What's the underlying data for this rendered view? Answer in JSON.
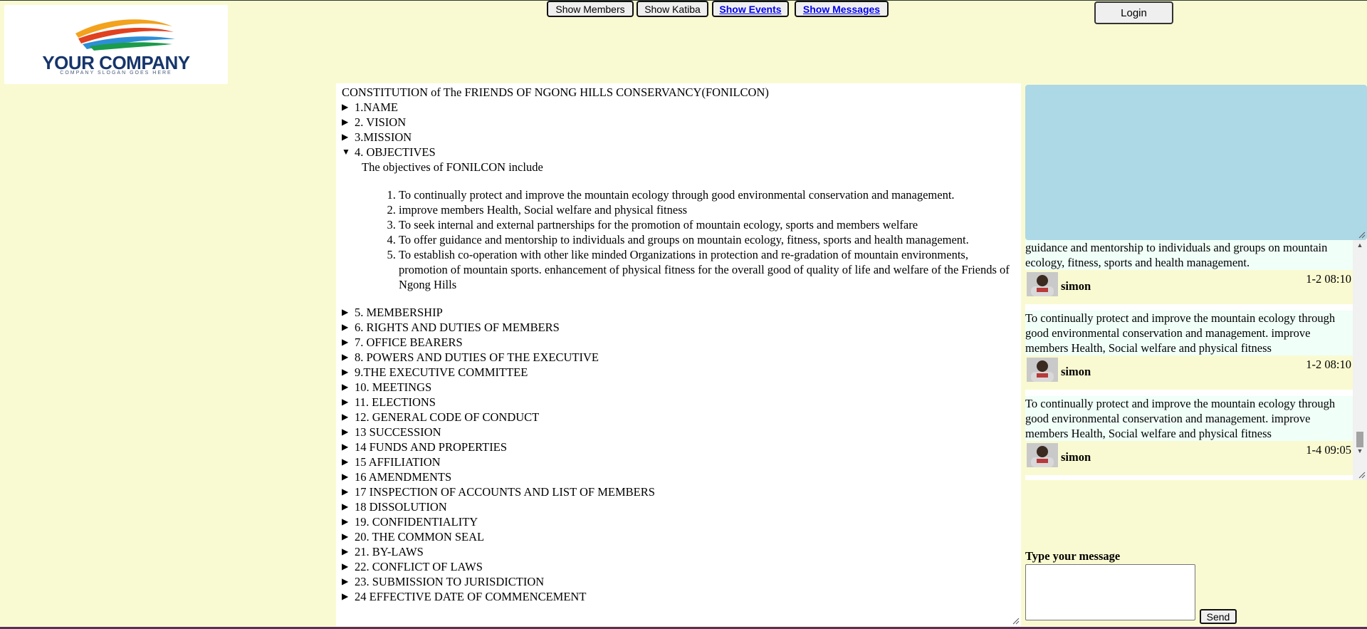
{
  "logo": {
    "name": "YOUR COMPANY",
    "slogan": "COMPANY SLOGAN GOES HERE"
  },
  "nav": {
    "show_members": "Show Members",
    "show_katiba": "Show Katiba",
    "show_events": "Show Events",
    "show_messages": "Show Messages",
    "login": "Login"
  },
  "doc": {
    "title": "CONSTITUTION of The FRIENDS OF NGONG HILLS CONSERVANCY(FONILCON)",
    "sections_before": [
      "1.NAME",
      "2. VISION",
      "3.MISSION"
    ],
    "open_section": {
      "label": "4. OBJECTIVES",
      "intro": "The objectives of FONILCON include",
      "items": [
        "To continually protect and improve the mountain ecology through good environmental conservation and management.",
        "improve members Health, Social welfare and physical fitness",
        "To seek internal and external partnerships for the promotion of mountain ecology, sports and members welfare",
        "To offer guidance and mentorship to individuals and groups on mountain ecology, fitness, sports and health management.",
        "To establish co-operation with other like minded Organizations in protection and re-gradation of mountain environments, promotion of mountain sports. enhancement of physical fitness for the overall good of quality of life and welfare of the Friends of Ngong Hills"
      ]
    },
    "sections_after": [
      "5. MEMBERSHIP",
      "6. RIGHTS AND DUTIES OF MEMBERS",
      "7. OFFICE BEARERS",
      "8. POWERS AND DUTIES OF THE EXECUTIVE",
      "9.THE EXECUTIVE COMMITTEE",
      "10. MEETINGS",
      "11. ELECTIONS",
      "12. GENERAL CODE OF CONDUCT",
      "13 SUCCESSION",
      "14 FUNDS AND PROPERTIES",
      "15 AFFILIATION",
      "16 AMENDMENTS",
      "17 INSPECTION OF ACCOUNTS AND LIST OF MEMBERS",
      "18 DISSOLUTION",
      "19. CONFIDENTIALITY",
      "20. THE COMMON SEAL",
      "21. BY-LAWS",
      "22. CONFLICT OF LAWS",
      "23. SUBMISSION TO JURISDICTION",
      "24 EFFECTIVE DATE OF COMMENCEMENT"
    ]
  },
  "messages": [
    {
      "text": "guidance and mentorship to individuals and groups on mountain ecology, fitness, sports and health management.",
      "time": "1-2 08:10",
      "user": "simon"
    },
    {
      "text": "To continually protect and improve the mountain ecology through good environmental conservation and management. improve members Health, Social welfare and physical fitness",
      "time": "1-2 08:10",
      "user": "simon"
    },
    {
      "text": "To continually protect and improve the mountain ecology through good environmental conservation and management. improve members Health, Social welfare and physical fitness",
      "time": "1-4 09:05",
      "user": "simon"
    }
  ],
  "compose": {
    "label": "Type your message",
    "value": "",
    "send": "Send"
  },
  "colors": {
    "page_bg": "#fafad2",
    "chat_image_bg": "#add8e6",
    "link": "#0000ee"
  },
  "icons": {
    "collapsed": "triangle-right-icon",
    "expanded": "triangle-down-icon"
  }
}
